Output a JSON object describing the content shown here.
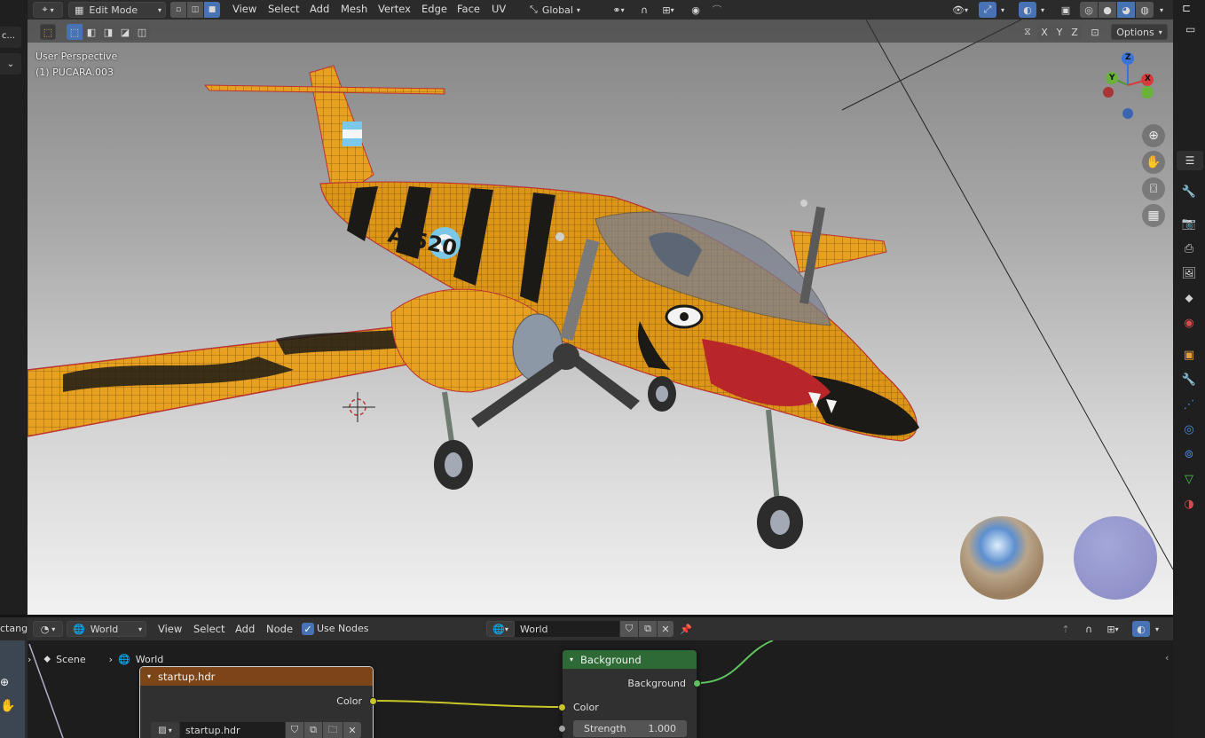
{
  "header": {
    "mode": "Edit Mode",
    "menus": [
      "View",
      "Select",
      "Add",
      "Mesh",
      "Vertex",
      "Edge",
      "Face",
      "UV"
    ],
    "transform_orientation": "Global"
  },
  "tool_header": {
    "axes": [
      "X",
      "Y",
      "Z"
    ],
    "options_label": "Options"
  },
  "viewport": {
    "perspective_label": "User Perspective",
    "object_label": "(1) PUCARA.003",
    "gizmo_axes": [
      "Z",
      "Y",
      "X"
    ]
  },
  "aircraft": {
    "tail_number": "A-520",
    "colors": {
      "body": "#e8a020",
      "stripe": "#1c1a16",
      "wire": "#3a2a10",
      "canopy": "#7a7f8e",
      "roundel": "#7cc8e8"
    }
  },
  "node_editor": {
    "editor_type": "World",
    "menus": [
      "View",
      "Select",
      "Add",
      "Node"
    ],
    "use_nodes_label": "Use Nodes",
    "use_nodes_checked": true,
    "world_name": "World",
    "breadcrumb": [
      "Scene",
      "World"
    ],
    "left_edge_label": "ctang",
    "image_node": {
      "title": "startup.hdr",
      "output_label": "Color",
      "image_name": "startup.hdr",
      "header_color": "#7b4518"
    },
    "background_node": {
      "title": "Background",
      "output_label": "Background",
      "input_color_label": "Color",
      "strength_label": "Strength",
      "strength_value": "1.000",
      "header_color": "#2d6a35"
    }
  },
  "left_panel": {
    "truncated_label": "c..."
  },
  "accent_color": "#4772b3"
}
